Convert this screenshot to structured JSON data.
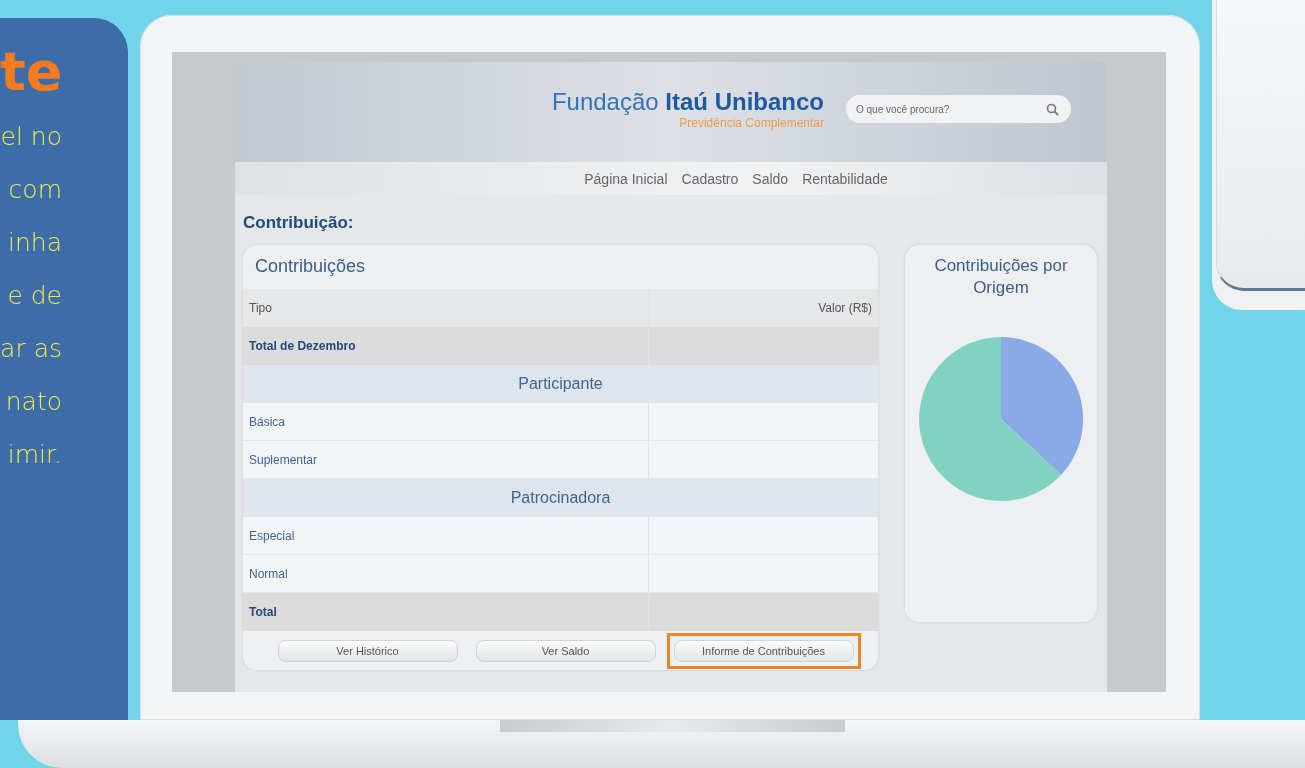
{
  "side_panel": {
    "heading": "te",
    "lines": [
      "el no",
      "com",
      "inha",
      "e de",
      "ar as",
      "nato",
      "imir."
    ]
  },
  "site": {
    "logo_light": "Fundação",
    "logo_bold": "Itaú Unibanco",
    "logo_subtitle": "Previdência Complementar",
    "search": {
      "placeholder": "O que você procura?"
    },
    "nav": [
      "Página Inicial",
      "Cadastro",
      "Saldo",
      "Rentabilidade"
    ],
    "page_title": "Contribuição:",
    "table_card": {
      "title": "Contribuições",
      "rows": [
        {
          "kind": "header",
          "cells": [
            "Tipo",
            "Valor (R$)"
          ]
        },
        {
          "kind": "total",
          "cells": [
            "Total de Dezembro"
          ]
        },
        {
          "kind": "section",
          "cells": [
            "Participante"
          ]
        },
        {
          "kind": "item",
          "cells": [
            "Básica"
          ]
        },
        {
          "kind": "item",
          "cells": [
            "Suplementar"
          ]
        },
        {
          "kind": "section",
          "cells": [
            "Patrocinadora"
          ]
        },
        {
          "kind": "item",
          "cells": [
            "Especial"
          ]
        },
        {
          "kind": "item",
          "cells": [
            "Normal"
          ]
        },
        {
          "kind": "total",
          "cells": [
            "Total"
          ]
        }
      ],
      "buttons": [
        {
          "label": "Ver Histórico",
          "highlighted": false
        },
        {
          "label": "Ver Saldo",
          "highlighted": false
        },
        {
          "label": "Informe de Contribuições",
          "highlighted": true
        }
      ]
    },
    "chart_card": {
      "title": "Contribuições por Origem"
    }
  }
}
